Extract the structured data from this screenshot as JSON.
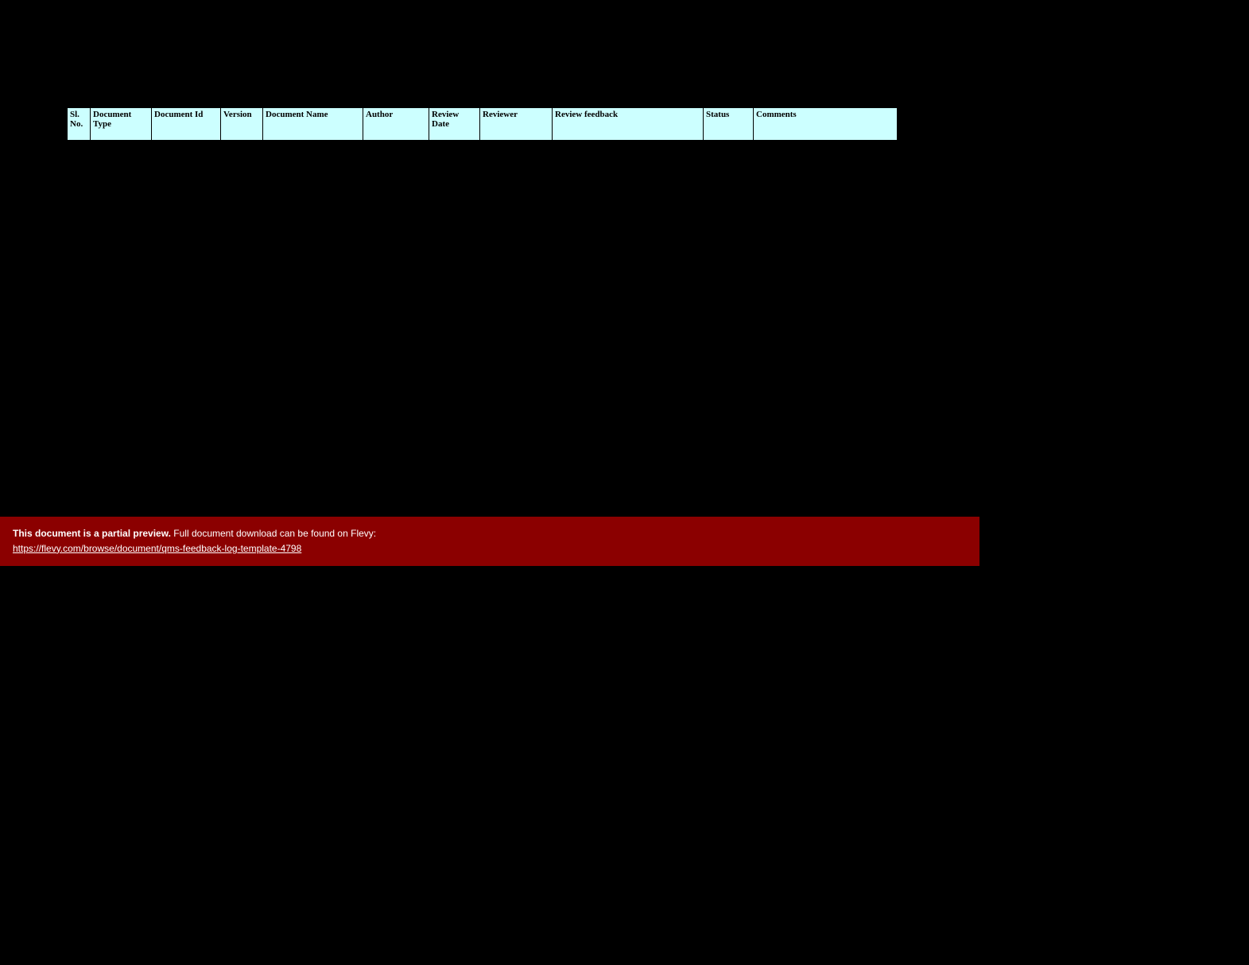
{
  "table": {
    "headers": {
      "sl": "Sl. No.",
      "doctype": "Document Type",
      "docid": "Document Id",
      "version": "Version",
      "docname": "Document Name",
      "author": "Author",
      "reviewdate": "Review Date",
      "reviewer": "Reviewer",
      "feedback": "Review feedback",
      "status": "Status",
      "comments": "Comments"
    }
  },
  "banner": {
    "strong": "This document is a partial preview.",
    "rest": "Full document download can be found on Flevy:",
    "link_text": "https://flevy.com/browse/document/qms-feedback-log-template-4798",
    "link_href": "https://flevy.com/browse/document/qms-feedback-log-template-4798"
  }
}
